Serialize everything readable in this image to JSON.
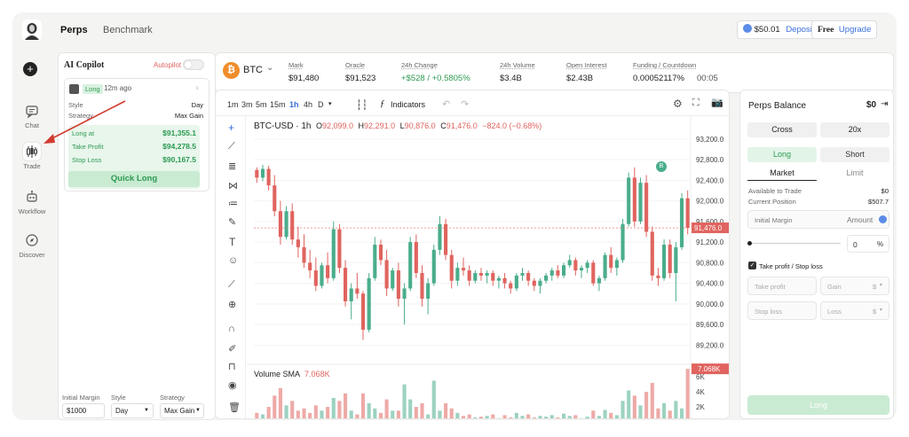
{
  "nav": {
    "items": [
      {
        "label": "Chat"
      },
      {
        "label": "Trade"
      },
      {
        "label": "Workflow"
      },
      {
        "label": "Discover"
      }
    ],
    "new_icon": "plus-icon"
  },
  "topbar": {
    "tabs": [
      "Perps",
      "Benchmark"
    ],
    "balance": "$50.01",
    "deposit": "Deposit",
    "plan": "Free",
    "upgrade": "Upgrade"
  },
  "copilot": {
    "title": "AI Copilot",
    "autopilot": "Autopilot",
    "card": {
      "side": "Long",
      "time": "12m ago",
      "style_label": "Style",
      "style_value": "Day",
      "strategy_label": "Strategy",
      "strategy_value": "Max Gain",
      "long_at_label": "Long at",
      "long_at": "$91,355.1",
      "tp_label": "Take Profit",
      "tp": "$94,278.5",
      "sl_label": "Stop Loss",
      "sl": "$90,167.5",
      "button": "Quick Long"
    },
    "form": {
      "margin_label": "Initial Margin",
      "margin_value": "$1000",
      "style_label": "Style",
      "style_value": "Day",
      "strategy_label": "Strategy",
      "strategy_value": "Max Gain"
    }
  },
  "ticker": {
    "symbol": "BTC",
    "stats": [
      {
        "label": "Mark",
        "value": "$91,480"
      },
      {
        "label": "Oracle",
        "value": "$91,523"
      },
      {
        "label": "24h Change",
        "value": "+$528 / +0.5805%"
      },
      {
        "label": "24h Volume",
        "value": "$3.4B"
      },
      {
        "label": "Open Interest",
        "value": "$2.43B"
      },
      {
        "label": "Funding / Countdown",
        "value": "0.00052117%",
        "extra": "00:05"
      }
    ]
  },
  "toolbar": {
    "intervals": [
      "1m",
      "3m",
      "5m",
      "15m",
      "1h",
      "4h",
      "D"
    ],
    "active_interval": "1h",
    "indicators": "Indicators"
  },
  "chart_header": {
    "pair": "BTC-USD · 1h",
    "o_label": "O",
    "o": "92,099.0",
    "h_label": "H",
    "h": "92,291.0",
    "l_label": "L",
    "l": "90,876.0",
    "c_label": "C",
    "c": "91,476.0",
    "change": "−824.0 (−0.68%)"
  },
  "volume_header": {
    "label": "Volume SMA",
    "value": "7.068K"
  },
  "colors": {
    "up": "#4aad8c",
    "down": "#e0645f",
    "accent": "#3a6fd8"
  },
  "chart_data": {
    "type": "candlestick",
    "y_ticks": [
      "93,200.0",
      "92,800.0",
      "92,400.0",
      "92,000.0",
      "91,600.0",
      "91,200.0",
      "90,800.0",
      "90,400.0",
      "90,000.0",
      "89,600.0",
      "89,200.0"
    ],
    "ylim": [
      89000,
      93300
    ],
    "current_price": "91,476.0",
    "volume_ticks": [
      "6K",
      "4K",
      "2K"
    ],
    "volume_current": "7.068K",
    "candles": [
      [
        92600,
        92650,
        92350,
        92450
      ],
      [
        92450,
        92700,
        92380,
        92620
      ],
      [
        92620,
        92680,
        92200,
        92300
      ],
      [
        92300,
        92500,
        91700,
        91800
      ],
      [
        91800,
        92000,
        91150,
        91300
      ],
      [
        91300,
        91900,
        91250,
        91800
      ],
      [
        91800,
        91950,
        91150,
        91250
      ],
      [
        91250,
        91500,
        90900,
        91100
      ],
      [
        91100,
        91350,
        90700,
        90800
      ],
      [
        90800,
        91050,
        90500,
        90650
      ],
      [
        90650,
        90900,
        90250,
        90350
      ],
      [
        90350,
        90800,
        90300,
        90750
      ],
      [
        90750,
        91000,
        90400,
        90500
      ],
      [
        90500,
        91600,
        90450,
        91450
      ],
      [
        91450,
        91550,
        90600,
        90700
      ],
      [
        90700,
        90850,
        89950,
        90050
      ],
      [
        90050,
        90400,
        89700,
        90300
      ],
      [
        90300,
        90600,
        90100,
        90200
      ],
      [
        90200,
        90250,
        89300,
        89500
      ],
      [
        89500,
        90600,
        89450,
        90500
      ],
      [
        90500,
        91300,
        90450,
        91150
      ],
      [
        91150,
        91250,
        90750,
        90850
      ],
      [
        90850,
        91050,
        90150,
        90300
      ],
      [
        90300,
        90700,
        90250,
        90650
      ],
      [
        90650,
        90800,
        89950,
        90100
      ],
      [
        90100,
        90400,
        89600,
        90300
      ],
      [
        90300,
        91300,
        90250,
        91200
      ],
      [
        91200,
        91350,
        90500,
        90600
      ],
      [
        90600,
        90750,
        89950,
        90100
      ],
      [
        90100,
        90500,
        89800,
        90400
      ],
      [
        90400,
        91150,
        90350,
        91050
      ],
      [
        91050,
        91700,
        90950,
        91550
      ],
      [
        91550,
        91650,
        90850,
        90950
      ],
      [
        90950,
        91050,
        90300,
        90450
      ],
      [
        90450,
        90800,
        90350,
        90700
      ],
      [
        90700,
        90900,
        90550,
        90650
      ],
      [
        90650,
        90750,
        90350,
        90450
      ],
      [
        90450,
        90650,
        90400,
        90600
      ],
      [
        90600,
        90700,
        90450,
        90550
      ],
      [
        90550,
        90650,
        90400,
        90600
      ],
      [
        90600,
        90650,
        90350,
        90450
      ],
      [
        90450,
        90550,
        90300,
        90500
      ],
      [
        90500,
        90600,
        90300,
        90400
      ],
      [
        90400,
        90450,
        90200,
        90300
      ],
      [
        90300,
        90600,
        90250,
        90550
      ],
      [
        90550,
        90700,
        90450,
        90600
      ],
      [
        90600,
        90650,
        90350,
        90450
      ],
      [
        90450,
        90500,
        90250,
        90350
      ],
      [
        90350,
        90500,
        90200,
        90450
      ],
      [
        90450,
        90600,
        90400,
        90550
      ],
      [
        90550,
        90700,
        90450,
        90650
      ],
      [
        90650,
        90750,
        90500,
        90550
      ],
      [
        90550,
        90800,
        90500,
        90750
      ],
      [
        90750,
        90950,
        90700,
        90850
      ],
      [
        90850,
        90900,
        90550,
        90650
      ],
      [
        90650,
        90750,
        90500,
        90700
      ],
      [
        90700,
        90850,
        90600,
        90800
      ],
      [
        90800,
        90850,
        90350,
        90400
      ],
      [
        90400,
        90550,
        90250,
        90500
      ],
      [
        90500,
        91000,
        90450,
        90950
      ],
      [
        90950,
        91100,
        90600,
        90700
      ],
      [
        90700,
        90900,
        90550,
        90850
      ],
      [
        90850,
        91650,
        90800,
        91550
      ],
      [
        91550,
        92550,
        91500,
        92450
      ],
      [
        92450,
        92650,
        91500,
        91600
      ],
      [
        91600,
        92450,
        91550,
        92350
      ],
      [
        92350,
        92500,
        91300,
        91400
      ],
      [
        91400,
        91500,
        90450,
        90550
      ],
      [
        90550,
        90700,
        90350,
        90500
      ],
      [
        90500,
        91250,
        90450,
        91150
      ],
      [
        91150,
        91250,
        90500,
        90600
      ],
      [
        90600,
        91200,
        90050,
        91100
      ],
      [
        91100,
        92150,
        91050,
        92050
      ],
      [
        92050,
        92200,
        91350,
        91476
      ]
    ],
    "volumes": [
      1.2,
      1.0,
      2.0,
      3.5,
      4.5,
      2.2,
      2.8,
      1.5,
      1.8,
      1.2,
      2.2,
      1.5,
      2.0,
      3.2,
      2.8,
      3.8,
      1.5,
      1.0,
      3.8,
      2.5,
      1.8,
      1.2,
      3.0,
      1.5,
      1.5,
      5.0,
      3.0,
      2.0,
      2.5,
      1.0,
      5.5,
      1.5,
      2.5,
      1.8,
      1.2,
      0.8,
      1.0,
      0.6,
      0.7,
      0.8,
      1.0,
      0.5,
      0.9,
      0.6,
      1.2,
      0.8,
      1.0,
      0.6,
      0.8,
      0.7,
      0.9,
      0.6,
      1.1,
      0.8,
      0.9,
      0.5,
      0.7,
      1.5,
      0.8,
      1.6,
      1.2,
      0.9,
      2.8,
      4.2,
      3.5,
      2.2,
      4.0,
      5.2,
      1.8,
      2.5,
      1.5,
      2.8,
      1.8,
      7.068
    ]
  },
  "order": {
    "balance_label": "Perps Balance",
    "balance_value": "$0",
    "margin_mode": "Cross",
    "leverage": "20x",
    "long": "Long",
    "short": "Short",
    "market": "Market",
    "limit": "Limit",
    "available_label": "Available to Trade",
    "available_value": "$0",
    "position_label": "Current Position",
    "position_value": "$507.7",
    "margin_label": "Initial Margin",
    "amount_label": "Amount",
    "percent_value": "0",
    "percent_unit": "%",
    "tpsl_label": "Take profit / Stop loss",
    "tp_placeholder": "Take profit",
    "gain_placeholder": "Gain",
    "sl_placeholder": "Stop loss",
    "loss_placeholder": "Loss",
    "unit": "$",
    "submit": "Long"
  }
}
